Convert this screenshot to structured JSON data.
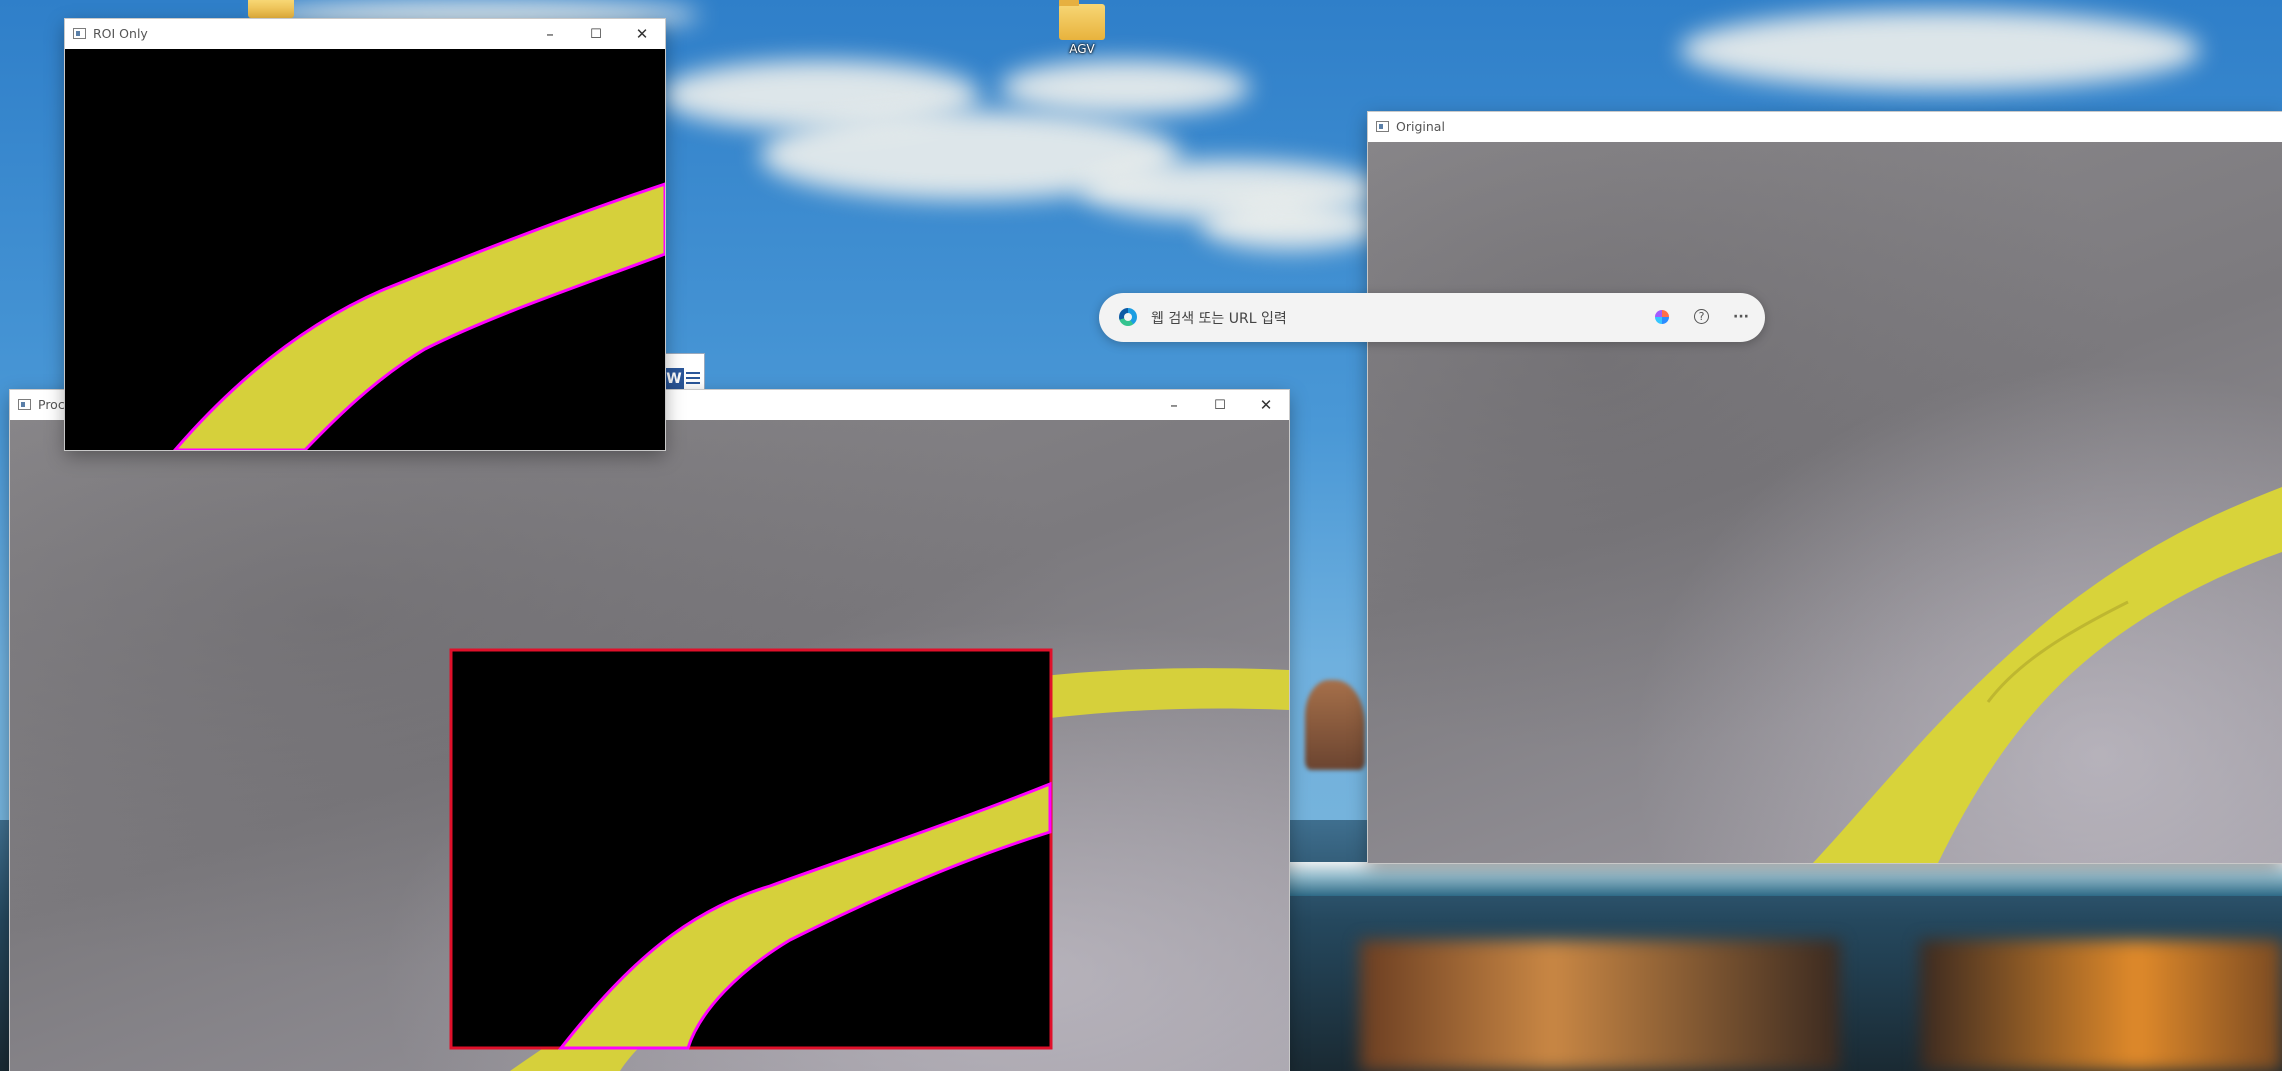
{
  "desktop": {
    "icons": [
      {
        "label": "AGV"
      }
    ]
  },
  "windows": {
    "roi": {
      "title": "ROI Only"
    },
    "processed": {
      "title": "Proce"
    },
    "original": {
      "title": "Original"
    }
  },
  "controls": {
    "minimize": "–",
    "maximize": "☐",
    "close": "✕"
  },
  "browser_bar": {
    "placeholder": "웹 검색 또는 URL 입력",
    "help": "?",
    "more": "···"
  },
  "colors": {
    "tape_yellow": "#d9d23a",
    "contour_magenta": "#ff00ff",
    "roi_rect_red": "#e0102a"
  }
}
